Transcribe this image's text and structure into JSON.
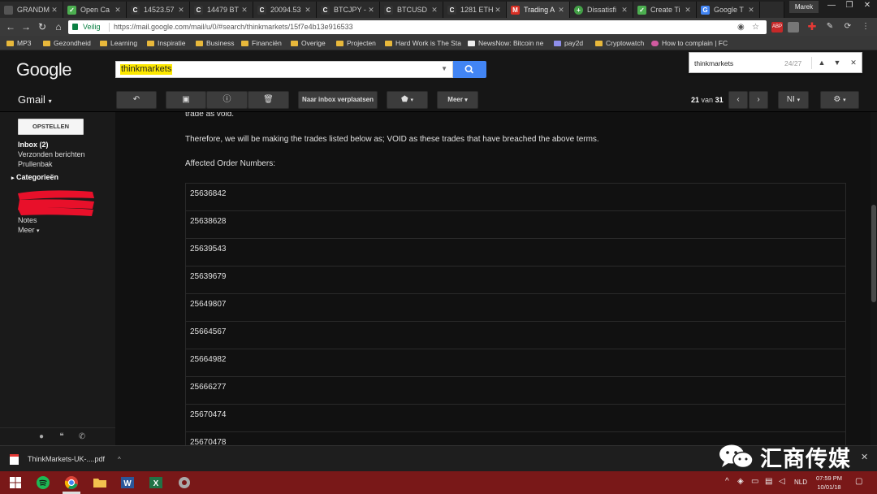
{
  "browser": {
    "tabs": [
      {
        "title": "GRANDM",
        "favicon": "doc-icon",
        "favicon_color": "#555555"
      },
      {
        "title": "Open Ca",
        "favicon": "shield-icon",
        "favicon_color": "#4caf50"
      },
      {
        "title": "14523.57",
        "favicon": "c-icon",
        "favicon_color": "#333333"
      },
      {
        "title": "14479 BT",
        "favicon": "c-icon",
        "favicon_color": "#333333"
      },
      {
        "title": "20094.53",
        "favicon": "c-icon",
        "favicon_color": "#333333"
      },
      {
        "title": "BTCJPY -",
        "favicon": "c-icon",
        "favicon_color": "#333333"
      },
      {
        "title": "BTCUSD",
        "favicon": "c-icon",
        "favicon_color": "#333333"
      },
      {
        "title": "1281 ETH",
        "favicon": "c-icon",
        "favicon_color": "#333333"
      },
      {
        "title": "Trading A",
        "favicon": "gmail-icon",
        "favicon_color": "#d93025"
      },
      {
        "title": "Dissatisfi",
        "favicon": "plus-icon",
        "favicon_color": "#43a047"
      },
      {
        "title": "Create Ti",
        "favicon": "shield-icon",
        "favicon_color": "#4caf50"
      },
      {
        "title": "Google T",
        "favicon": "google-icon",
        "favicon_color": "#4285f4"
      }
    ],
    "user": "Marek",
    "win_controls": {
      "minimize": "—",
      "restore": "❐",
      "close": "✕"
    },
    "nav": {
      "back": "←",
      "forward": "→",
      "reload": "↻",
      "home": "⌂"
    },
    "secure_label": "Veilig",
    "url": "https://mail.google.com/mail/u/0/#search/thinkmarkets/15f7e4b13e916533",
    "bookmarks": [
      {
        "label": "MP3",
        "type": "folder"
      },
      {
        "label": "Gezondheid",
        "type": "folder"
      },
      {
        "label": "Learning",
        "type": "folder"
      },
      {
        "label": "Inspiratie",
        "type": "folder"
      },
      {
        "label": "Business",
        "type": "folder"
      },
      {
        "label": "Financiën",
        "type": "folder"
      },
      {
        "label": "Overige",
        "type": "folder"
      },
      {
        "label": "Projecten",
        "type": "folder"
      },
      {
        "label": "Hard Work is The Sta",
        "type": "folder"
      },
      {
        "label": "NewsNow: Bitcoin ne",
        "type": "site"
      },
      {
        "label": "pay2d",
        "type": "site"
      },
      {
        "label": "Cryptowatch",
        "type": "folder"
      },
      {
        "label": "How to complain | FC",
        "type": "site"
      }
    ]
  },
  "gmail": {
    "logo": "Google",
    "search_query": "thinkmarkets",
    "label": "Gmail",
    "toolbar": {
      "move_label": "Naar inbox verplaatsen",
      "more_label": "Meer",
      "page_current": "21",
      "page_of": "van",
      "page_total": "31",
      "lang": "NI"
    },
    "find": {
      "query": "thinkmarkets",
      "count": "24/27"
    },
    "sidebar": {
      "compose": "OPSTELLEN",
      "items": [
        "Inbox (2)",
        "Verzonden berichten",
        "Prullenbak"
      ],
      "categories": "Categorieën",
      "notes": "Notes",
      "more": "Meer"
    },
    "message": {
      "line_top": "trade as void.",
      "line_void": "Therefore, we will be making the trades listed below as; VOID as these trades that have breached the above terms.",
      "affected_heading": "Affected Order Numbers:",
      "orders": [
        "25636842",
        "25638628",
        "25639543",
        "25639679",
        "25649807",
        "25664567",
        "25664982",
        "25666277",
        "25670474",
        "25670478"
      ]
    }
  },
  "download": {
    "file": "ThinkMarkets-UK-....pdf"
  },
  "watermark": {
    "text": "汇商传媒"
  },
  "taskbar": {
    "lang": "NLD",
    "time": "07:59 PM",
    "date": "10/01/18"
  },
  "colors": {
    "taskbar": "#791818",
    "search_button": "#4285f4",
    "highlight": "#fde800"
  }
}
